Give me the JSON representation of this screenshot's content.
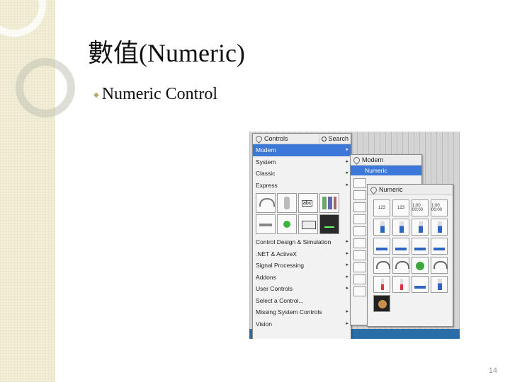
{
  "slide": {
    "title": "數值(Numeric)",
    "bullet": "Numeric Control",
    "page_number": "14"
  },
  "controls_palette": {
    "title": "Controls",
    "search_label": "Search",
    "items": [
      {
        "label": "Modern",
        "active": true,
        "has_submenu": true
      },
      {
        "label": "System",
        "active": false,
        "has_submenu": true
      },
      {
        "label": "Classic",
        "active": false,
        "has_submenu": true
      },
      {
        "label": "Express",
        "active": false,
        "has_submenu": true
      }
    ],
    "items_after_icons": [
      {
        "label": "Control Design & Simulation",
        "has_submenu": true
      },
      {
        "label": ".NET & ActiveX",
        "has_submenu": true
      },
      {
        "label": "Signal Processing",
        "has_submenu": true
      },
      {
        "label": "Addons",
        "has_submenu": true
      },
      {
        "label": "User Controls",
        "has_submenu": true
      },
      {
        "label": "Select a Control...",
        "has_submenu": false
      },
      {
        "label": "Missing System Controls",
        "has_submenu": true
      },
      {
        "label": "Vision",
        "has_submenu": true
      }
    ],
    "arrow_glyph": "▸"
  },
  "modern_palette": {
    "title": "Modern",
    "selected": "Numeric"
  },
  "numeric_palette": {
    "title": "Numeric",
    "digital_labels": [
      "123",
      "123",
      "1:00 00:00",
      "1:00 00:00"
    ]
  },
  "colors": {
    "selection_blue": "#3b78d8",
    "indicator_green": "#3aa83a",
    "slide_accent": "#b8a968"
  }
}
